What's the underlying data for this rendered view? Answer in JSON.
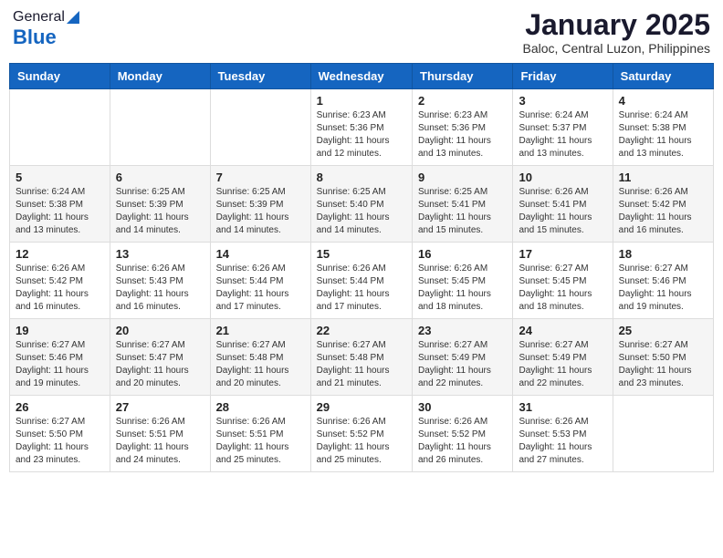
{
  "header": {
    "logo_general": "General",
    "logo_blue": "Blue",
    "title": "January 2025",
    "subtitle": "Baloc, Central Luzon, Philippines"
  },
  "days_of_week": [
    "Sunday",
    "Monday",
    "Tuesday",
    "Wednesday",
    "Thursday",
    "Friday",
    "Saturday"
  ],
  "weeks": [
    [
      {
        "day": "",
        "info": ""
      },
      {
        "day": "",
        "info": ""
      },
      {
        "day": "",
        "info": ""
      },
      {
        "day": "1",
        "info": "Sunrise: 6:23 AM\nSunset: 5:36 PM\nDaylight: 11 hours and 12 minutes."
      },
      {
        "day": "2",
        "info": "Sunrise: 6:23 AM\nSunset: 5:36 PM\nDaylight: 11 hours and 13 minutes."
      },
      {
        "day": "3",
        "info": "Sunrise: 6:24 AM\nSunset: 5:37 PM\nDaylight: 11 hours and 13 minutes."
      },
      {
        "day": "4",
        "info": "Sunrise: 6:24 AM\nSunset: 5:38 PM\nDaylight: 11 hours and 13 minutes."
      }
    ],
    [
      {
        "day": "5",
        "info": "Sunrise: 6:24 AM\nSunset: 5:38 PM\nDaylight: 11 hours and 13 minutes."
      },
      {
        "day": "6",
        "info": "Sunrise: 6:25 AM\nSunset: 5:39 PM\nDaylight: 11 hours and 14 minutes."
      },
      {
        "day": "7",
        "info": "Sunrise: 6:25 AM\nSunset: 5:39 PM\nDaylight: 11 hours and 14 minutes."
      },
      {
        "day": "8",
        "info": "Sunrise: 6:25 AM\nSunset: 5:40 PM\nDaylight: 11 hours and 14 minutes."
      },
      {
        "day": "9",
        "info": "Sunrise: 6:25 AM\nSunset: 5:41 PM\nDaylight: 11 hours and 15 minutes."
      },
      {
        "day": "10",
        "info": "Sunrise: 6:26 AM\nSunset: 5:41 PM\nDaylight: 11 hours and 15 minutes."
      },
      {
        "day": "11",
        "info": "Sunrise: 6:26 AM\nSunset: 5:42 PM\nDaylight: 11 hours and 16 minutes."
      }
    ],
    [
      {
        "day": "12",
        "info": "Sunrise: 6:26 AM\nSunset: 5:42 PM\nDaylight: 11 hours and 16 minutes."
      },
      {
        "day": "13",
        "info": "Sunrise: 6:26 AM\nSunset: 5:43 PM\nDaylight: 11 hours and 16 minutes."
      },
      {
        "day": "14",
        "info": "Sunrise: 6:26 AM\nSunset: 5:44 PM\nDaylight: 11 hours and 17 minutes."
      },
      {
        "day": "15",
        "info": "Sunrise: 6:26 AM\nSunset: 5:44 PM\nDaylight: 11 hours and 17 minutes."
      },
      {
        "day": "16",
        "info": "Sunrise: 6:26 AM\nSunset: 5:45 PM\nDaylight: 11 hours and 18 minutes."
      },
      {
        "day": "17",
        "info": "Sunrise: 6:27 AM\nSunset: 5:45 PM\nDaylight: 11 hours and 18 minutes."
      },
      {
        "day": "18",
        "info": "Sunrise: 6:27 AM\nSunset: 5:46 PM\nDaylight: 11 hours and 19 minutes."
      }
    ],
    [
      {
        "day": "19",
        "info": "Sunrise: 6:27 AM\nSunset: 5:46 PM\nDaylight: 11 hours and 19 minutes."
      },
      {
        "day": "20",
        "info": "Sunrise: 6:27 AM\nSunset: 5:47 PM\nDaylight: 11 hours and 20 minutes."
      },
      {
        "day": "21",
        "info": "Sunrise: 6:27 AM\nSunset: 5:48 PM\nDaylight: 11 hours and 20 minutes."
      },
      {
        "day": "22",
        "info": "Sunrise: 6:27 AM\nSunset: 5:48 PM\nDaylight: 11 hours and 21 minutes."
      },
      {
        "day": "23",
        "info": "Sunrise: 6:27 AM\nSunset: 5:49 PM\nDaylight: 11 hours and 22 minutes."
      },
      {
        "day": "24",
        "info": "Sunrise: 6:27 AM\nSunset: 5:49 PM\nDaylight: 11 hours and 22 minutes."
      },
      {
        "day": "25",
        "info": "Sunrise: 6:27 AM\nSunset: 5:50 PM\nDaylight: 11 hours and 23 minutes."
      }
    ],
    [
      {
        "day": "26",
        "info": "Sunrise: 6:27 AM\nSunset: 5:50 PM\nDaylight: 11 hours and 23 minutes."
      },
      {
        "day": "27",
        "info": "Sunrise: 6:26 AM\nSunset: 5:51 PM\nDaylight: 11 hours and 24 minutes."
      },
      {
        "day": "28",
        "info": "Sunrise: 6:26 AM\nSunset: 5:51 PM\nDaylight: 11 hours and 25 minutes."
      },
      {
        "day": "29",
        "info": "Sunrise: 6:26 AM\nSunset: 5:52 PM\nDaylight: 11 hours and 25 minutes."
      },
      {
        "day": "30",
        "info": "Sunrise: 6:26 AM\nSunset: 5:52 PM\nDaylight: 11 hours and 26 minutes."
      },
      {
        "day": "31",
        "info": "Sunrise: 6:26 AM\nSunset: 5:53 PM\nDaylight: 11 hours and 27 minutes."
      },
      {
        "day": "",
        "info": ""
      }
    ]
  ]
}
